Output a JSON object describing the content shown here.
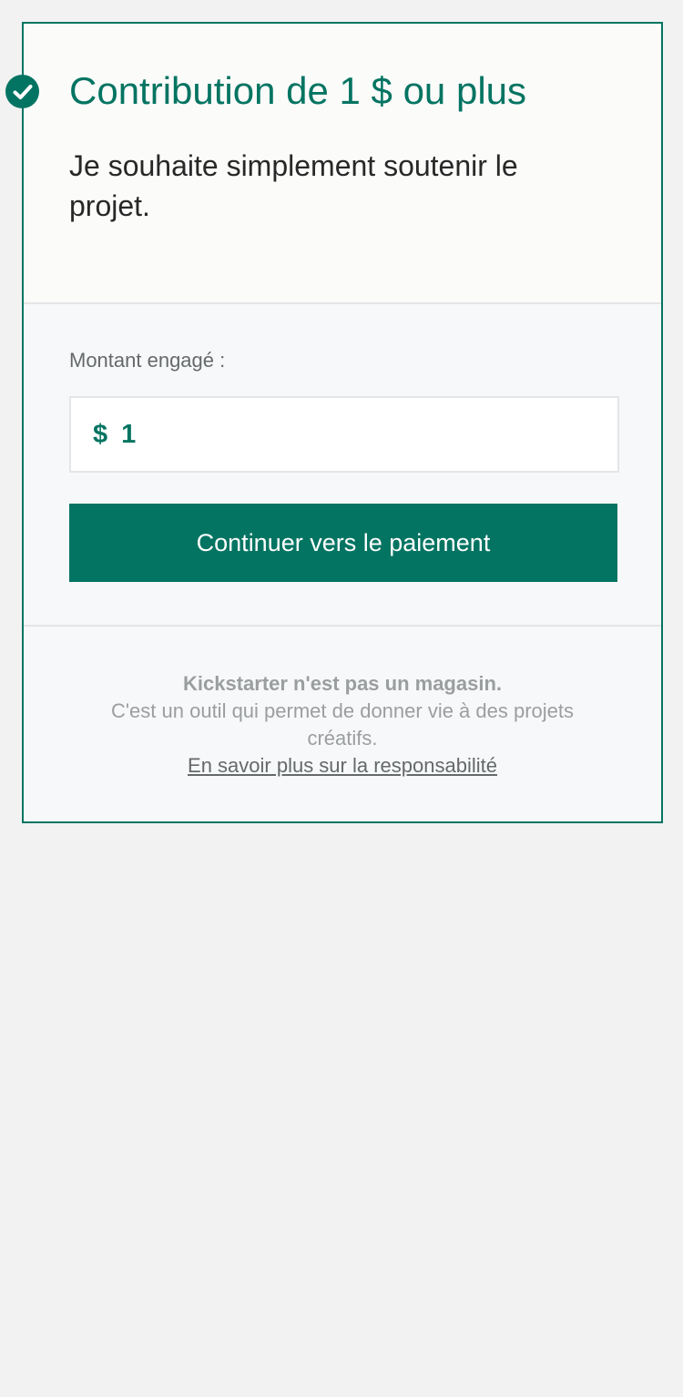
{
  "reward": {
    "title": "Contribution de 1 $ ou plus",
    "description": "Je souhaite simplement soutenir le projet.",
    "selected_icon": "check-circle-icon"
  },
  "pledge": {
    "label": "Montant engagé :",
    "currency_symbol": "$",
    "amount": "1",
    "continue_label": "Continuer vers le paiement"
  },
  "footer": {
    "title": "Kickstarter n'est pas un magasin.",
    "text": "C'est un outil qui permet de donner vie à des projets créatifs.",
    "link": "En savoir plus sur la responsabilité"
  },
  "colors": {
    "accent": "#047462",
    "page_background": "#f2f2f2",
    "card_background": "#f7f8fa",
    "muted_text": "#9b9e9e"
  }
}
